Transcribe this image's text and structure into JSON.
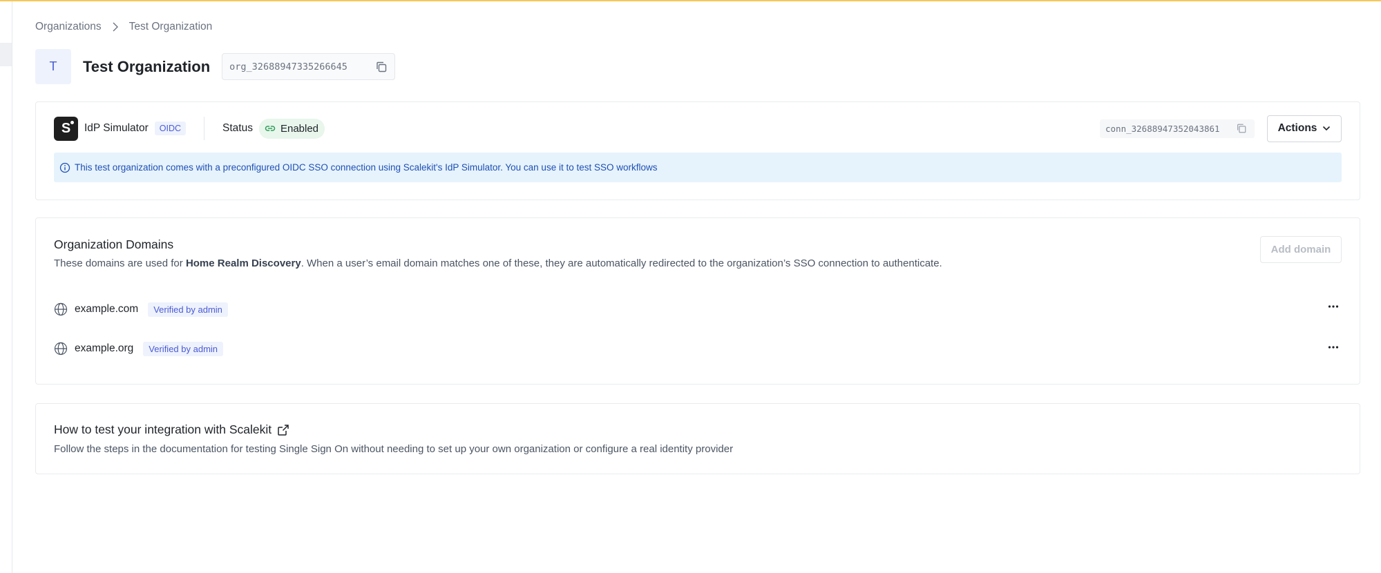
{
  "breadcrumb": {
    "items": [
      "Organizations",
      "Test Organization"
    ]
  },
  "organization": {
    "avatar_letter": "T",
    "name": "Test Organization",
    "id": "org_32688947335266645"
  },
  "sso_connection": {
    "idp_logo_letter": "S",
    "idp_name": "IdP Simulator",
    "protocol": "OIDC",
    "status_label": "Status",
    "status_value": "Enabled",
    "connection_id": "conn_32688947352043861",
    "actions_label": "Actions",
    "info_text": "This test organization comes with a preconfigured OIDC SSO connection using Scalekit's IdP Simulator. You can use it to test SSO workflows"
  },
  "domains": {
    "title": "Organization Domains",
    "description_before": "These domains are used for ",
    "description_bold": "Home Realm Discovery",
    "description_after": ". When a user’s email domain matches one of these, they are automatically redirected to the organization’s SSO connection to authenticate.",
    "add_button": "Add domain",
    "items": [
      {
        "name": "example.com",
        "badge": "Verified by admin"
      },
      {
        "name": "example.org",
        "badge": "Verified by admin"
      }
    ]
  },
  "howto": {
    "title": "How to test your integration with Scalekit",
    "description": "Follow the steps in the documentation for testing Single Sign On without needing to set up your own organization or configure a real identity provider"
  },
  "colors": {
    "accent_top": "#f6c75a",
    "badge_bg": "#eef2fc",
    "badge_text": "#4a5bd4",
    "enabled_bg": "#e8f6ec",
    "enabled_icon": "#2f9e5a",
    "info_bg": "#e6f3fc",
    "info_text": "#1f4fb5"
  }
}
